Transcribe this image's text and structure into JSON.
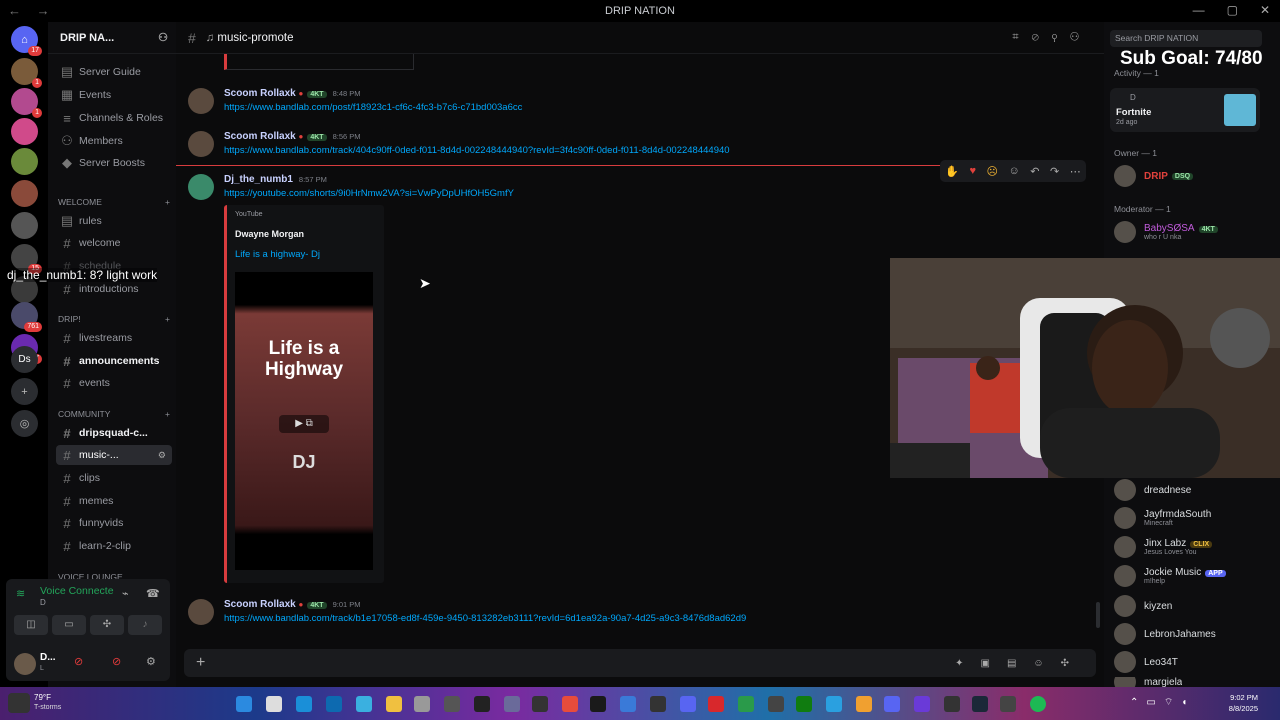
{
  "window": {
    "title": "DRIP NATION",
    "controls": [
      "—",
      "▢",
      "✕"
    ]
  },
  "overlay": {
    "sub_goal": "Sub Goal: 74/80",
    "chat_line": "dj_the_numb1: 8? light work"
  },
  "server_rail": {
    "badges": [
      "17",
      "1",
      "1",
      "15",
      "761",
      "327"
    ],
    "ds_label": "Ds"
  },
  "channel_sidebar": {
    "server_name": "DRIP NA...",
    "top_items": [
      "Server Guide",
      "Events",
      "Channels & Roles",
      "Members",
      "Server Boosts"
    ],
    "categories": [
      {
        "name": "WELCOME",
        "channels": [
          "rules",
          "welcome",
          "schedule",
          "introductions"
        ]
      },
      {
        "name": "DRIP!",
        "channels": [
          "livestreams",
          "announcements",
          "events"
        ]
      },
      {
        "name": "COMMUNITY",
        "channels": [
          "dripsquad-c...",
          "music-...",
          "clips",
          "memes",
          "funnyvids",
          "learn-2-clip"
        ]
      },
      {
        "name": "VOICE LOUNGE",
        "channels": []
      }
    ],
    "voice": {
      "status": "Voice Connecte",
      "sub": "D"
    },
    "user": {
      "name": "D...",
      "sub": "L"
    }
  },
  "main": {
    "channel_name": "music-promote",
    "messages": [
      {
        "author": "Scoom Rollaxk",
        "badge": "4KT",
        "time": "8:48 PM",
        "link": "https://www.bandlab.com/post/f18923c1-cf6c-4fc3-b7c6-c71bd003a6cc"
      },
      {
        "author": "Scoom Rollaxk",
        "badge": "4KT",
        "time": "8:56 PM",
        "link": "https://www.bandlab.com/track/404c90ff-0ded-f011-8d4d-002248444940?revId=3f4c90ff-0ded-f011-8d4d-002248444940"
      },
      {
        "author": "Dj_the_numb1",
        "badge": "",
        "time": "8:57 PM",
        "link": "https://youtube.com/shorts/9i0HrNmw2VA?si=VwPyDpUHfOH5GmfY"
      },
      {
        "author": "Scoom Rollaxk",
        "badge": "4KT",
        "time": "9:01 PM",
        "link": "https://www.bandlab.com/track/b1e17058-ed8f-459e-9450-813282eb3111?revId=6d1ea92a-90a7-4d25-a9c3-8476d8ad62d9"
      }
    ],
    "embed": {
      "provider": "YouTube",
      "author": "Dwayne Morgan",
      "title": "Life is a highway- Dj",
      "thumb_text": "Life is a Highway",
      "thumb_sub": "DJ"
    }
  },
  "right_panel": {
    "search_placeholder": "Search DRIP NATION",
    "activity_header": "Activity — 1",
    "activity": {
      "user": "D",
      "game": "Fortnite",
      "ago": "2d ago"
    },
    "owner_header": "Owner — 1",
    "owner": {
      "name": "DRIP",
      "tag": "DSQ"
    },
    "moderator_header": "Moderator — 1",
    "moderator": {
      "name": "BabySØSA",
      "tag": "4KT",
      "sub": "who r U nka"
    },
    "members": [
      {
        "name": "dreadnese",
        "sub": ""
      },
      {
        "name": "JayfrmdaSouth",
        "sub": "Minecraft"
      },
      {
        "name": "Jinx Labz",
        "sub": "Jesus Loves You",
        "tag": "CLIX"
      },
      {
        "name": "Jockie Music",
        "sub": "m!help",
        "tag": "APP"
      },
      {
        "name": "kiyzen",
        "sub": ""
      },
      {
        "name": "LebronJahames",
        "sub": ""
      },
      {
        "name": "Leo34T",
        "sub": ""
      },
      {
        "name": "margiela",
        "sub": ""
      }
    ]
  },
  "taskbar": {
    "weather": "79°F",
    "weather_sub": "T-storms",
    "time": "9:02 PM",
    "date": "8/8/2025"
  },
  "colors": {
    "accent": "#00a8fc",
    "embed_border": "#d83c3e",
    "name": "#c9d2ff",
    "owner": "#e0413c",
    "mod": "#c15bdb"
  }
}
